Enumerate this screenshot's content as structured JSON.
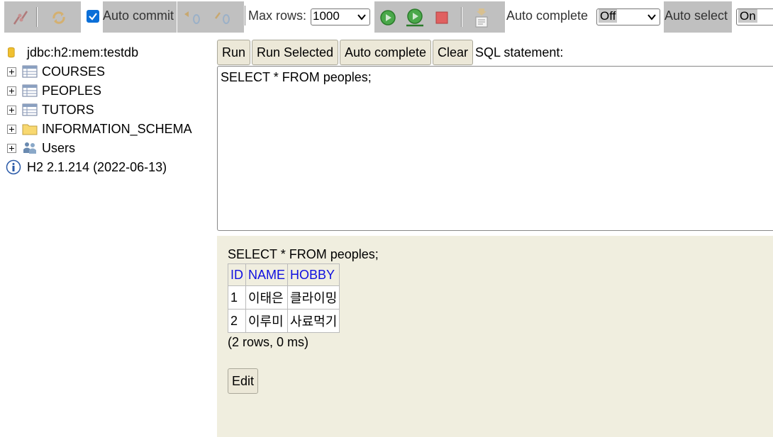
{
  "toolbar": {
    "autocommit_label": "Auto commit",
    "autocommit_checked": true,
    "maxrows_label": "Max rows:",
    "maxrows_value": "1000",
    "autocomplete_label": "Auto complete",
    "autocomplete_value": "Off",
    "autoselect_label": "Auto select",
    "autoselect_value": "On",
    "icons": [
      "disconnect-icon",
      "refresh-icon",
      "rollback-icon",
      "commit-icon",
      "run-icon",
      "run-selected-icon",
      "stop-icon",
      "history-icon"
    ],
    "colors": {
      "panel": "#c0c0c0",
      "run_green": "#2a9a2a",
      "stop_red": "#e05050"
    }
  },
  "tree": {
    "connection": "jdbc:h2:mem:testdb",
    "items": [
      {
        "label": "COURSES",
        "icon": "table-icon"
      },
      {
        "label": "PEOPLES",
        "icon": "table-icon"
      },
      {
        "label": "TUTORS",
        "icon": "table-icon"
      },
      {
        "label": "INFORMATION_SCHEMA",
        "icon": "folder-icon"
      },
      {
        "label": "Users",
        "icon": "users-icon"
      }
    ],
    "version": "H2 2.1.214 (2022-06-13)"
  },
  "query": {
    "run_label": "Run",
    "run_selected_label": "Run Selected",
    "auto_complete_label": "Auto complete",
    "clear_label": "Clear",
    "sql_label": "SQL statement:",
    "sql_text": "SELECT * FROM peoples;"
  },
  "result": {
    "statement": "SELECT * FROM peoples;",
    "columns": [
      "ID",
      "NAME",
      "HOBBY"
    ],
    "rows": [
      [
        "1",
        "이태은",
        "클라이밍"
      ],
      [
        "2",
        "이루미",
        "사료먹기"
      ]
    ],
    "summary": "(2 rows, 0 ms)",
    "edit_label": "Edit"
  }
}
